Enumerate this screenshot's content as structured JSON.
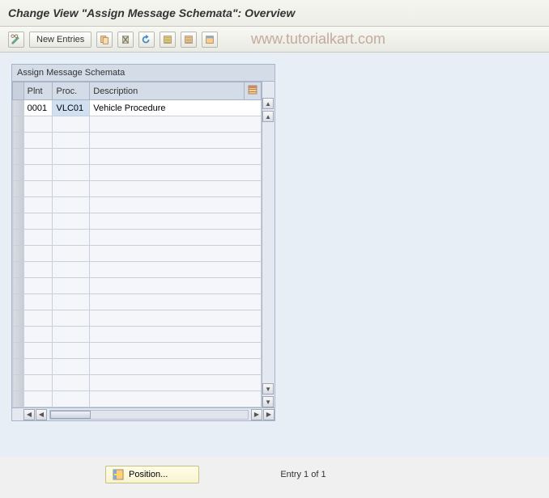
{
  "title": "Change View \"Assign Message Schemata\": Overview",
  "watermark": "www.tutorialkart.com",
  "toolbar": {
    "new_entries_label": "New Entries"
  },
  "table": {
    "title": "Assign Message Schemata",
    "columns": {
      "plnt": "Plnt",
      "proc": "Proc.",
      "desc": "Description"
    },
    "rows": [
      {
        "plnt": "0001",
        "proc": "VLC01",
        "desc": "Vehicle Procedure"
      }
    ],
    "empty_row_count": 18
  },
  "footer": {
    "position_label": "Position...",
    "entry_status": "Entry 1 of 1"
  }
}
